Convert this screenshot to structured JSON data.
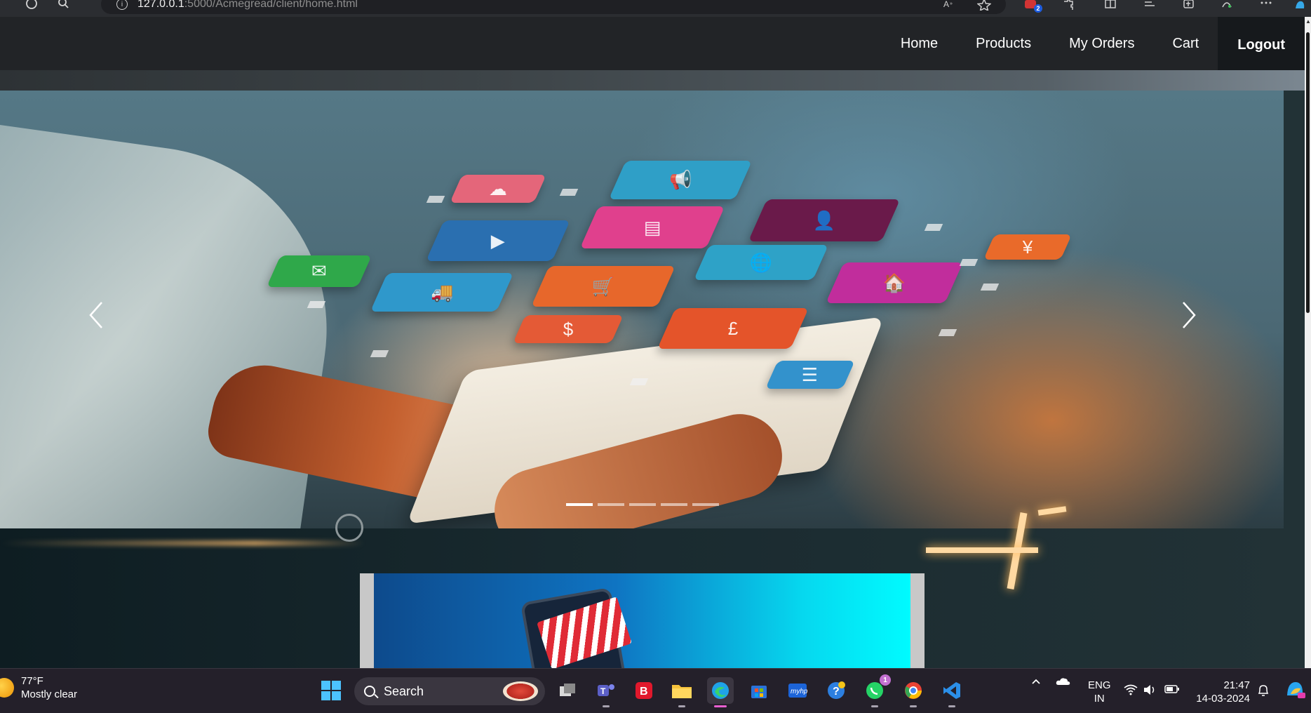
{
  "browser": {
    "url_host": "127.0.0.1",
    "url_path": ":5000/Acmegread/client/home.html",
    "extension_badge": "2"
  },
  "nav": {
    "items": [
      {
        "label": "Home"
      },
      {
        "label": "Products"
      },
      {
        "label": "My Orders"
      },
      {
        "label": "Cart"
      },
      {
        "label": "Logout"
      }
    ]
  },
  "carousel": {
    "active_slide": 1,
    "slide_count": 5
  },
  "taskbar": {
    "weather_temp": "77°F",
    "weather_desc": "Mostly clear",
    "search_placeholder": "Search",
    "whatsapp_badge": "1",
    "lang_primary": "ENG",
    "lang_region": "IN",
    "time": "21:47",
    "date": "14-03-2024"
  },
  "colors": {
    "nav_bg": "#222427",
    "logout_bg": "#16191c",
    "taskbar_bg": "#24202a",
    "banner_start": "#0d4a8c",
    "banner_end": "#00fbff"
  }
}
